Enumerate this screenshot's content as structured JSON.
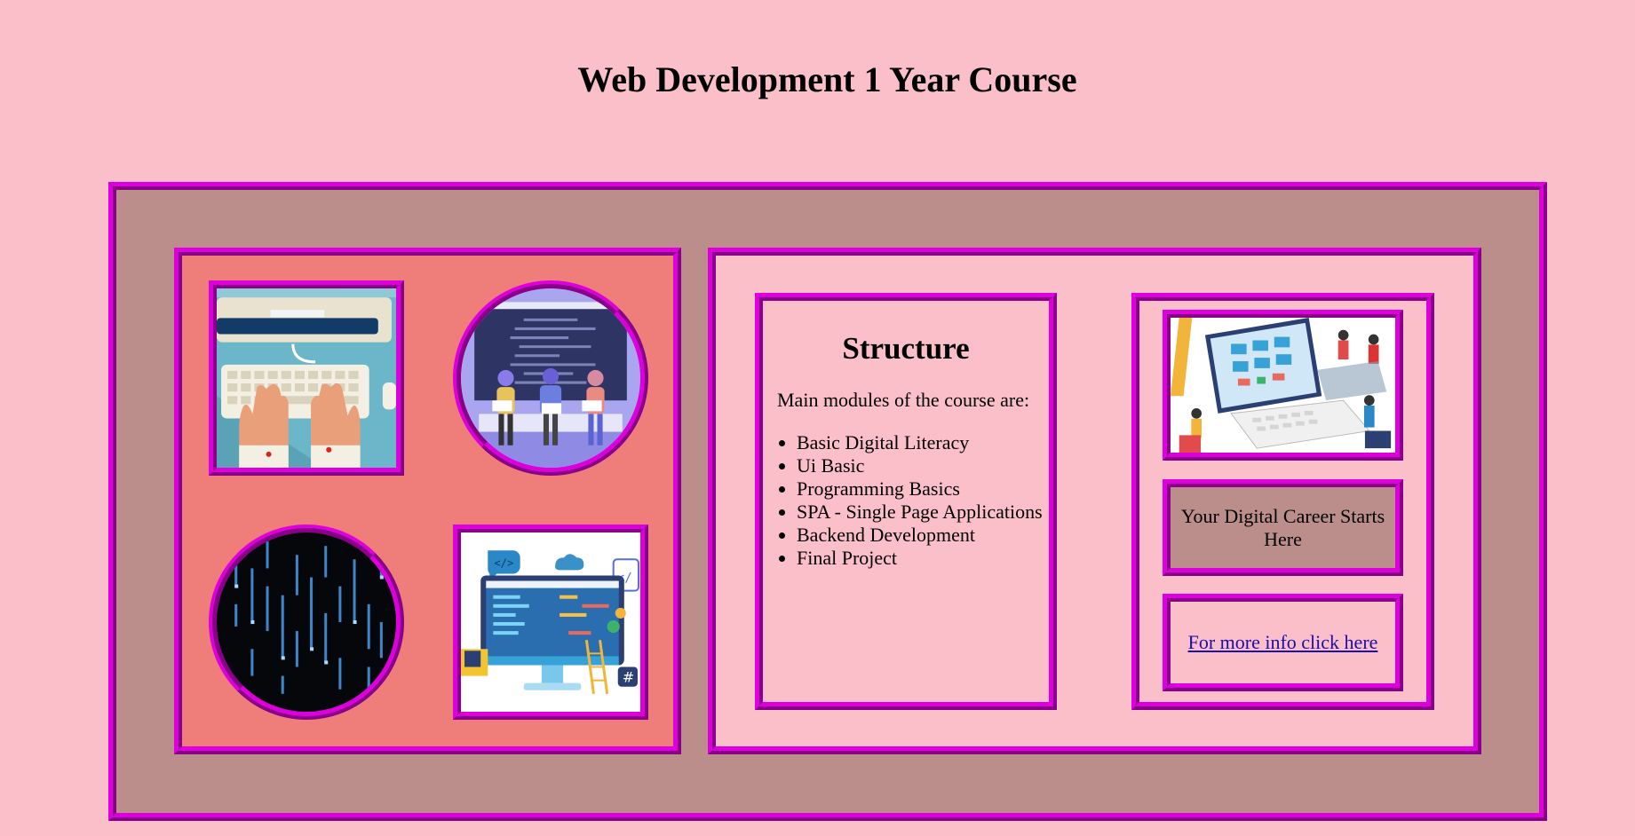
{
  "page": {
    "title": "Web Development 1 Year Course"
  },
  "structure": {
    "heading": "Structure",
    "intro": "Main modules of the course are:",
    "modules": [
      "Basic Digital Literacy",
      "Ui Basic",
      "Programming Basics",
      "SPA - Single Page Applications",
      "Backend Development",
      "Final Project"
    ]
  },
  "sidebar": {
    "tagline": "Your Digital Career Starts Here",
    "info_link": "For more info click here"
  },
  "colors": {
    "page_background": "#fbbfca",
    "outer_panel": "#bc8e8b",
    "gallery_panel": "#ef7d7a",
    "border": "#dd00dd",
    "link": "#1a0dab"
  },
  "images": [
    {
      "name": "keyboard-typing-image"
    },
    {
      "name": "team-coding-image"
    },
    {
      "name": "digital-code-rain-image"
    },
    {
      "name": "web-development-illustration"
    },
    {
      "name": "isometric-dev-team-image"
    }
  ]
}
